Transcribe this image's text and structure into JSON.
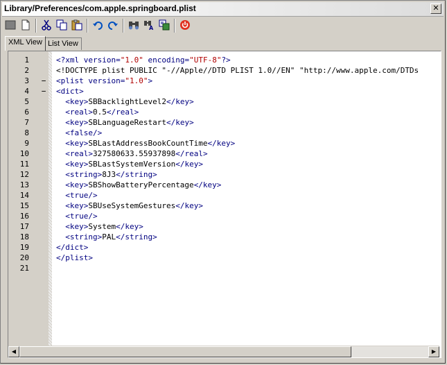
{
  "window": {
    "title": "Library/Preferences/com.apple.springboard.plist",
    "close_label": "✕"
  },
  "toolbar": {
    "buttons": [
      {
        "name": "gray-square-icon"
      },
      {
        "name": "new-document-icon"
      },
      {
        "name": "cut-icon"
      },
      {
        "name": "copy-icon"
      },
      {
        "name": "paste-icon"
      },
      {
        "name": "undo-icon"
      },
      {
        "name": "redo-icon"
      },
      {
        "name": "find-icon"
      },
      {
        "name": "find-replace-icon"
      },
      {
        "name": "goto-icon"
      },
      {
        "name": "power-icon"
      }
    ]
  },
  "tabs": [
    {
      "label": "XML View",
      "active": true
    },
    {
      "label": "List View",
      "active": false
    }
  ],
  "editor": {
    "lines": [
      {
        "n": "1",
        "fold": "",
        "segments": [
          [
            "tag",
            "<?xml version="
          ],
          [
            "str",
            "\"1.0\""
          ],
          [
            "tag",
            " encoding="
          ],
          [
            "str",
            "\"UTF-8\""
          ],
          [
            "tag",
            "?>"
          ]
        ]
      },
      {
        "n": "2",
        "fold": "",
        "segments": [
          [
            "txt",
            "<!DOCTYPE plist PUBLIC \"-//Apple//DTD PLIST 1.0//EN\" \"http://www.apple.com/DTDs"
          ]
        ]
      },
      {
        "n": "3",
        "fold": "−",
        "segments": [
          [
            "tag",
            "<plist version="
          ],
          [
            "str",
            "\"1.0\""
          ],
          [
            "tag",
            ">"
          ]
        ]
      },
      {
        "n": "4",
        "fold": "−",
        "segments": [
          [
            "tag",
            "<dict>"
          ]
        ]
      },
      {
        "n": "5",
        "fold": "",
        "segments": [
          [
            "tag",
            "  <key>"
          ],
          [
            "txt",
            "SBBacklightLevel2"
          ],
          [
            "tag",
            "</key>"
          ]
        ]
      },
      {
        "n": "6",
        "fold": "",
        "segments": [
          [
            "tag",
            "  <real>"
          ],
          [
            "txt",
            "0.5"
          ],
          [
            "tag",
            "</real>"
          ]
        ]
      },
      {
        "n": "7",
        "fold": "",
        "segments": [
          [
            "tag",
            "  <key>"
          ],
          [
            "txt",
            "SBLanguageRestart"
          ],
          [
            "tag",
            "</key>"
          ]
        ]
      },
      {
        "n": "8",
        "fold": "",
        "segments": [
          [
            "tag",
            "  <false/>"
          ]
        ]
      },
      {
        "n": "9",
        "fold": "",
        "segments": [
          [
            "tag",
            "  <key>"
          ],
          [
            "txt",
            "SBLastAddressBookCountTime"
          ],
          [
            "tag",
            "</key>"
          ]
        ]
      },
      {
        "n": "10",
        "fold": "",
        "segments": [
          [
            "tag",
            "  <real>"
          ],
          [
            "txt",
            "327580633.55937898"
          ],
          [
            "tag",
            "</real>"
          ]
        ]
      },
      {
        "n": "11",
        "fold": "",
        "segments": [
          [
            "tag",
            "  <key>"
          ],
          [
            "txt",
            "SBLastSystemVersion"
          ],
          [
            "tag",
            "</key>"
          ]
        ]
      },
      {
        "n": "12",
        "fold": "",
        "segments": [
          [
            "tag",
            "  <string>"
          ],
          [
            "txt",
            "8J3"
          ],
          [
            "tag",
            "</string>"
          ]
        ]
      },
      {
        "n": "13",
        "fold": "",
        "segments": [
          [
            "tag",
            "  <key>"
          ],
          [
            "txt",
            "SBShowBatteryPercentage"
          ],
          [
            "tag",
            "</key>"
          ]
        ]
      },
      {
        "n": "14",
        "fold": "",
        "segments": [
          [
            "tag",
            "  <true/>"
          ]
        ]
      },
      {
        "n": "15",
        "fold": "",
        "segments": [
          [
            "tag",
            "  <key>"
          ],
          [
            "txt",
            "SBUseSystemGestures"
          ],
          [
            "tag",
            "</key>"
          ]
        ]
      },
      {
        "n": "16",
        "fold": "",
        "segments": [
          [
            "tag",
            "  <true/>"
          ]
        ]
      },
      {
        "n": "17",
        "fold": "",
        "segments": [
          [
            "tag",
            "  <key>"
          ],
          [
            "txt",
            "System"
          ],
          [
            "tag",
            "</key>"
          ]
        ]
      },
      {
        "n": "18",
        "fold": "",
        "segments": [
          [
            "tag",
            "  <string>"
          ],
          [
            "txt",
            "PAL"
          ],
          [
            "tag",
            "</string>"
          ]
        ]
      },
      {
        "n": "19",
        "fold": "",
        "segments": [
          [
            "tag",
            "</dict>"
          ]
        ]
      },
      {
        "n": "20",
        "fold": "",
        "segments": [
          [
            "tag",
            "</plist>"
          ]
        ]
      },
      {
        "n": "21",
        "fold": "",
        "segments": []
      }
    ]
  },
  "scrollbar": {
    "left_arrow": "◀",
    "right_arrow": "▶"
  },
  "colors": {
    "tag": "#000080",
    "string": "#b00000",
    "chrome": "#d4d0c8"
  }
}
